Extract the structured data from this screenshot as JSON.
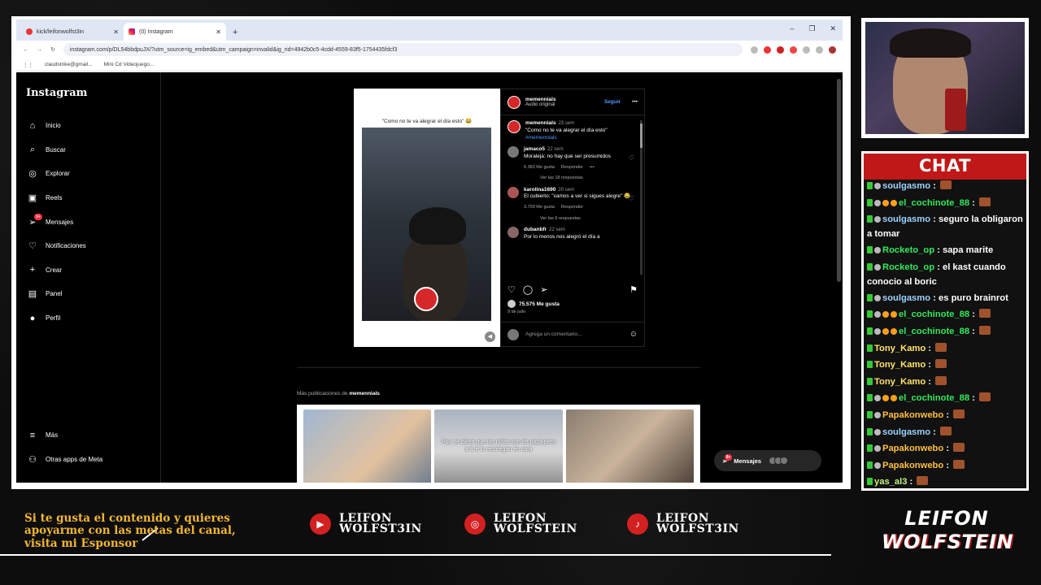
{
  "browser": {
    "tabs": [
      {
        "title": "kick/leifonwolfst3in",
        "active": false
      },
      {
        "title": "(0) Instagram",
        "active": true
      }
    ],
    "url": "instagram.com/p/DL54bbdpuJX/?utm_source=ig_embed&utm_campaign=invalid&ig_rid=4942b0c5-4cdd-4559-83f5-1754435fdcf3",
    "bookmarks": [
      "claudstrike@gmail...",
      "Mini Cd Videojuego..."
    ]
  },
  "instagram": {
    "logo": "Instagram",
    "nav": [
      {
        "label": "Inicio",
        "icon": "home-icon"
      },
      {
        "label": "Buscar",
        "icon": "search-icon"
      },
      {
        "label": "Explorar",
        "icon": "compass-icon"
      },
      {
        "label": "Reels",
        "icon": "reels-icon"
      },
      {
        "label": "Mensajes",
        "icon": "messages-icon",
        "badge": "9+"
      },
      {
        "label": "Notificaciones",
        "icon": "heart-icon"
      },
      {
        "label": "Crear",
        "icon": "plus-icon"
      },
      {
        "label": "Panel",
        "icon": "chart-icon"
      },
      {
        "label": "Perfil",
        "icon": "avatar-icon"
      }
    ],
    "nav_bottom": [
      {
        "label": "Más",
        "icon": "menu-icon"
      },
      {
        "label": "Otras apps de Meta",
        "icon": "meta-apps-icon"
      }
    ],
    "post": {
      "caption": "\"Como no te va alegrar el día esto\" 😂",
      "author": "memennials",
      "audio": "Audio original",
      "follow": "Seguir",
      "comments": [
        {
          "user": "memennials",
          "time": "23 sem",
          "text": "\"Como no te va alegrar el día esto\"",
          "tag": "#memennials"
        },
        {
          "user": "jamaco5",
          "time": "22 sem",
          "text": "Moraleja: no hay que ser presumidos",
          "likes": "6.383 Me gusta",
          "reply": "Responder",
          "more": "Ver las 18 respuestas"
        },
        {
          "user": "karolina1690",
          "time": "20 sem",
          "text": "El cubierto: \"vamos a ver si sigues alegre\" 😂",
          "likes": "3.709 Me gusta",
          "reply": "Responder",
          "more": "Ver las 6 respuestas"
        },
        {
          "user": "dubanbfr",
          "time": "22 sem",
          "text": "Por lo menos nos alegró el día a"
        }
      ],
      "likes": "75.575 Me gusta",
      "date": "9 de julio",
      "add_comment": "Agrega un comentario..."
    },
    "more_posts": {
      "prefix": "Más publicaciones de",
      "user": "memennials"
    },
    "thumb_caption": "Pov: te dicen que las niñas son de papá pero a ti te lo restriegan en cara",
    "messages_pill": {
      "label": "Mensajes",
      "badge": "9+"
    }
  },
  "chat": {
    "title": "CHAT",
    "messages": [
      {
        "user": "soulgasmo",
        "text": "",
        "badges": [
          "g",
          "w"
        ],
        "color": "n1",
        "emote": true
      },
      {
        "user": "el_cochinote_88",
        "text": "",
        "badges": [
          "g",
          "w",
          "o",
          "o"
        ],
        "color": "n2",
        "emote": true
      },
      {
        "user": "soulgasmo",
        "text": "seguro la obligaron a tomar",
        "badges": [
          "g",
          "w"
        ],
        "color": "n1"
      },
      {
        "user": "Rocketo_op",
        "text": "sapa marite",
        "badges": [
          "g",
          "w"
        ],
        "color": "n2"
      },
      {
        "user": "Rocketo_op",
        "text": "el kast cuando conocio al boric",
        "badges": [
          "g",
          "w"
        ],
        "color": "n2"
      },
      {
        "user": "soulgasmo",
        "text": "es puro brainrot",
        "badges": [
          "g",
          "w"
        ],
        "color": "n1"
      },
      {
        "user": "el_cochinote_88",
        "text": "",
        "badges": [
          "g",
          "w",
          "o",
          "o"
        ],
        "color": "n2",
        "emote": true
      },
      {
        "user": "el_cochinote_88",
        "text": "",
        "badges": [
          "g",
          "w",
          "o",
          "o"
        ],
        "color": "n2",
        "emote": true
      },
      {
        "user": "Tony_Kamo",
        "text": "",
        "badges": [
          "g"
        ],
        "color": "n3",
        "emote": true
      },
      {
        "user": "Tony_Kamo",
        "text": "",
        "badges": [
          "g"
        ],
        "color": "n3",
        "emote": true
      },
      {
        "user": "Tony_Kamo",
        "text": "",
        "badges": [
          "g"
        ],
        "color": "n3",
        "emote": true
      },
      {
        "user": "el_cochinote_88",
        "text": "",
        "badges": [
          "g",
          "w",
          "o",
          "o"
        ],
        "color": "n2",
        "emote": true
      },
      {
        "user": "Papakonwebo",
        "text": "",
        "badges": [
          "g",
          "w"
        ],
        "color": "n4",
        "emote": true
      },
      {
        "user": "soulgasmo",
        "text": "",
        "badges": [
          "g",
          "w"
        ],
        "color": "n1",
        "emote": true
      },
      {
        "user": "Papakonwebo",
        "text": "",
        "badges": [
          "g",
          "w"
        ],
        "color": "n4",
        "emote": true
      },
      {
        "user": "Papakonwebo",
        "text": "",
        "badges": [
          "g",
          "w"
        ],
        "color": "n4",
        "emote": true
      },
      {
        "user": "yas_al3",
        "text": "",
        "badges": [
          "g"
        ],
        "color": "n5",
        "emote": true
      }
    ]
  },
  "footer": {
    "promo": "Si te gusta el contenido y quieres apoyarme con las metas del canal, visita mi Esponsor",
    "socials": [
      {
        "icon": "youtube-icon",
        "line1": "LEIFON",
        "line2": "WOLFST3IN"
      },
      {
        "icon": "instagram-icon",
        "line1": "LEIFON",
        "line2": "WOLFSTEIN"
      },
      {
        "icon": "tiktok-icon",
        "line1": "LEIFON",
        "line2": "WOLFST3IN"
      }
    ],
    "brand_line1": "LEIFON",
    "brand_line2": "WOLFSTEIN"
  }
}
